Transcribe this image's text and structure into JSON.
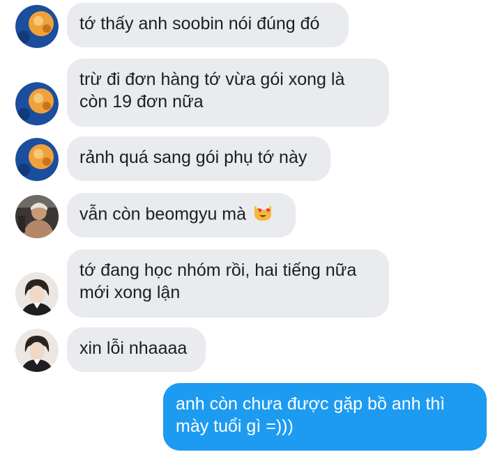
{
  "messages": [
    {
      "sender": "them",
      "avatar": "orange-planet-avatar",
      "lines": [
        "tớ thấy anh soobin nói đúng đó"
      ]
    },
    {
      "sender": "them",
      "avatar": "orange-planet-avatar",
      "lines": [
        "trừ đi đơn hàng tớ vừa gói xong là",
        "còn 19 đơn nữa"
      ]
    },
    {
      "sender": "them",
      "avatar": "orange-planet-avatar",
      "lines": [
        "rảnh quá sang gói phụ tớ này"
      ]
    },
    {
      "sender": "them",
      "avatar": "gym-photo-avatar",
      "lines": [
        "vẫn còn beomgyu mà"
      ],
      "emoji": "heart-eyes-cat-emoji"
    },
    {
      "sender": "them",
      "avatar": "portrait-avatar",
      "lines": [
        "tớ đang học nhóm rồi, hai tiếng nữa",
        "mới xong lận"
      ]
    },
    {
      "sender": "them",
      "avatar": "portrait-avatar",
      "lines": [
        "xin lỗi nhaaaa"
      ]
    },
    {
      "sender": "me",
      "lines": [
        "anh còn chưa được gặp bồ anh thì",
        "mày tuổi gì =)))"
      ]
    }
  ],
  "colors": {
    "incoming_bubble": "#e9ebee",
    "outgoing_bubble": "#1d9bf0",
    "incoming_text": "#1c1e21",
    "outgoing_text": "#ffffff"
  }
}
